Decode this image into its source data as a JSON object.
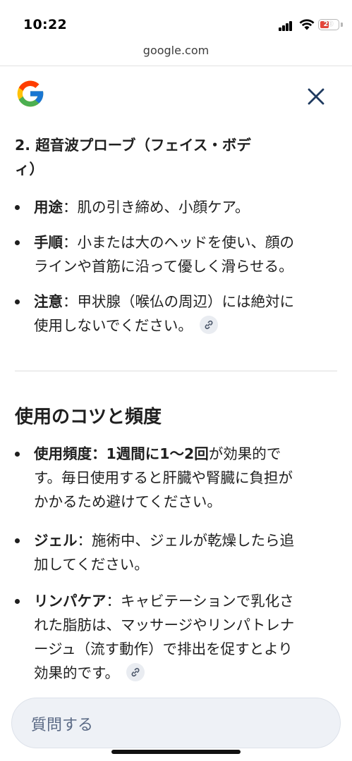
{
  "status": {
    "time": "10:22",
    "battery": "20",
    "battery_color": "#e6453a"
  },
  "browser": {
    "url": "google.com"
  },
  "header": {
    "logo": "google-g-logo",
    "close_icon": "close-icon"
  },
  "section2": {
    "heading_line1": "2. 超音波プローブ（フェイス・ボデ",
    "heading_line2": "ィ）",
    "bullets": [
      {
        "label": "用途",
        "sep": "：",
        "lines": [
          "肌の引き締め、小顔ケア。"
        ]
      },
      {
        "label": "手順",
        "sep": "：",
        "lines": [
          "小または大のヘッドを使い、顔の",
          "ラインや首筋に沿って優しく滑らせる。"
        ]
      },
      {
        "label": "注意",
        "sep": "：",
        "lines": [
          "甲状腺（喉仏の周辺）には絶対に",
          "使用しないでください。"
        ]
      }
    ]
  },
  "tips": {
    "heading": "使用のコツと頻度",
    "bullets": [
      {
        "label": "使用頻度",
        "sep": "：",
        "emph": "1週間に1〜2回",
        "lines": [
          "が効果的で",
          "す。毎日使用すると肝臓や腎臓に負担が",
          "かかるため避けてください。"
        ]
      },
      {
        "label": "ジェル",
        "sep": "：",
        "lines": [
          "施術中、ジェルが乾燥したら追",
          "加してください。"
        ]
      },
      {
        "label": "リンパケア",
        "sep": "：",
        "lines": [
          "キャビテーションで乳化さ",
          "れた脂肪は、マッサージやリンパトレナ",
          "ージュ（流す動作）で排出を促すとより",
          "効果的です。"
        ]
      }
    ]
  },
  "input": {
    "placeholder": "質問する"
  }
}
